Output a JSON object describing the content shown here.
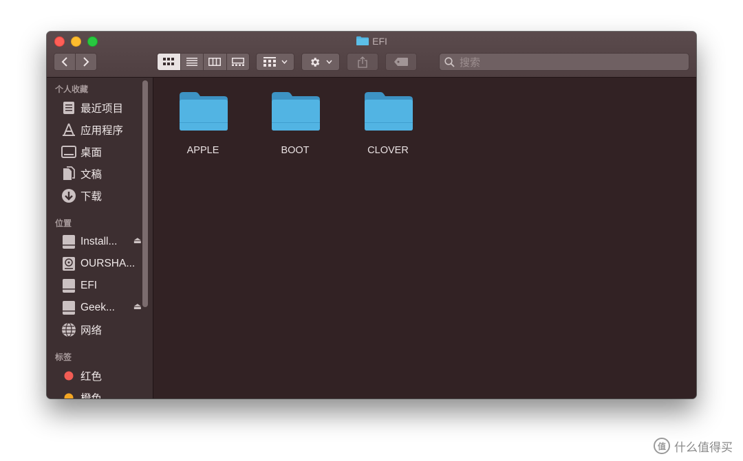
{
  "window": {
    "title": "EFI"
  },
  "toolbar": {
    "back_icon": "chevron-left-icon",
    "forward_icon": "chevron-right-icon",
    "view_modes": [
      "icon-view",
      "list-view",
      "column-view",
      "gallery-view"
    ],
    "active_view": "icon-view",
    "search_placeholder": "搜索"
  },
  "sidebar": {
    "sections": [
      {
        "title": "个人收藏",
        "items": [
          {
            "label": "最近项目",
            "icon": "recents-icon"
          },
          {
            "label": "应用程序",
            "icon": "applications-icon"
          },
          {
            "label": "桌面",
            "icon": "desktop-icon"
          },
          {
            "label": "文稿",
            "icon": "documents-icon"
          },
          {
            "label": "下载",
            "icon": "downloads-icon"
          }
        ]
      },
      {
        "title": "位置",
        "items": [
          {
            "label": "Install...",
            "icon": "drive-icon",
            "eject": true
          },
          {
            "label": "OURSHA...",
            "icon": "disk-icon",
            "eject": false
          },
          {
            "label": "EFI",
            "icon": "drive-icon",
            "eject": false
          },
          {
            "label": "Geek...",
            "icon": "drive-icon",
            "eject": true
          },
          {
            "label": "网络",
            "icon": "network-icon",
            "eject": false
          }
        ]
      },
      {
        "title": "标签",
        "items": [
          {
            "label": "红色",
            "icon": "tag-dot-icon",
            "color": "#f25c54"
          },
          {
            "label": "橙色",
            "icon": "tag-dot-icon",
            "color": "#f4a623"
          }
        ]
      }
    ]
  },
  "content": {
    "folders": [
      {
        "name": "APPLE"
      },
      {
        "name": "BOOT"
      },
      {
        "name": "CLOVER"
      }
    ]
  },
  "watermark": {
    "text": "什么值得买",
    "logo_text": "值"
  },
  "colors": {
    "folder_blue": "#4eb1de",
    "window_bg": "#322224",
    "sidebar_bg": "#3d2f31",
    "close": "#fe5f57",
    "minimize": "#febc2e",
    "maximize": "#28c840"
  }
}
